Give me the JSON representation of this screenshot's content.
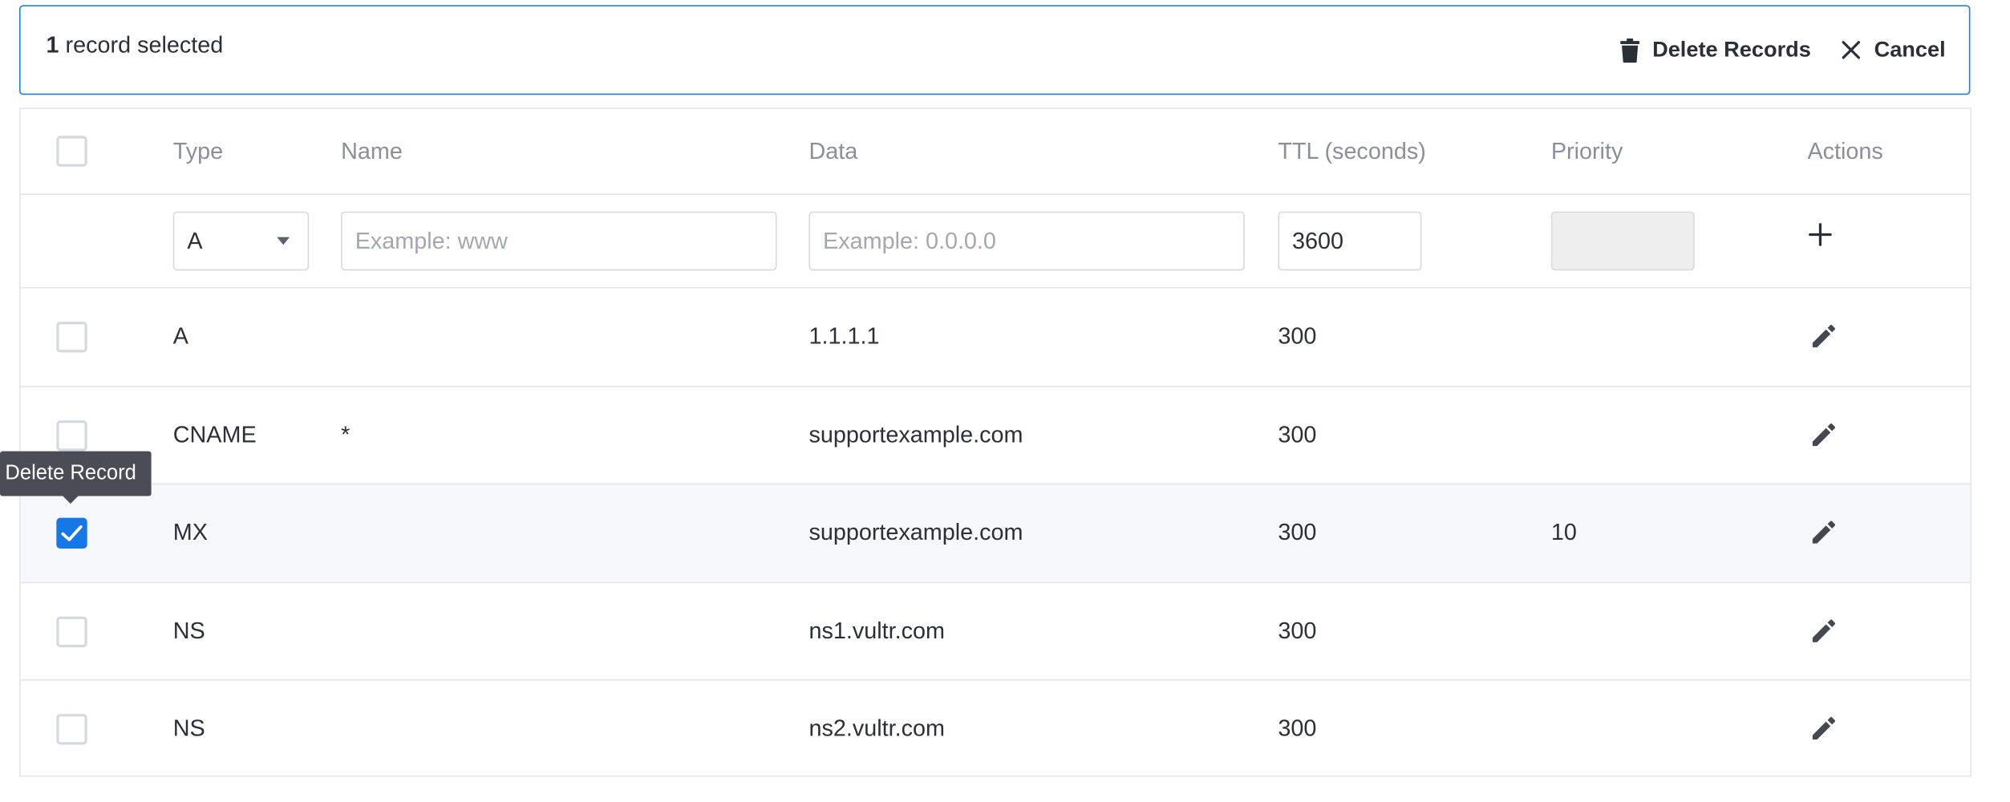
{
  "selection_bar": {
    "count": "1",
    "count_suffix": "record selected",
    "delete_label": "Delete Records",
    "cancel_label": "Cancel"
  },
  "columns": {
    "type": "Type",
    "name": "Name",
    "data": "Data",
    "ttl": "TTL (seconds)",
    "priority": "Priority",
    "actions": "Actions"
  },
  "new_record": {
    "type_value": "A",
    "name_placeholder": "Example: www",
    "data_placeholder": "Example: 0.0.0.0",
    "ttl_value": "3600",
    "priority_value": ""
  },
  "records": [
    {
      "type": "A",
      "name": "",
      "data": "1.1.1.1",
      "ttl": "300",
      "priority": "",
      "checked": false
    },
    {
      "type": "CNAME",
      "name": "*",
      "data": "supportexample.com",
      "ttl": "300",
      "priority": "",
      "checked": false
    },
    {
      "type": "MX",
      "name": "",
      "data": "supportexample.com",
      "ttl": "300",
      "priority": "10",
      "checked": true
    },
    {
      "type": "NS",
      "name": "",
      "data": "ns1.vultr.com",
      "ttl": "300",
      "priority": "",
      "checked": false
    },
    {
      "type": "NS",
      "name": "",
      "data": "ns2.vultr.com",
      "ttl": "300",
      "priority": "",
      "checked": false
    }
  ],
  "tooltip": "Delete Record",
  "colors": {
    "accent": "#1677e6",
    "border": "#e3e5ea",
    "tooltip_bg": "#4a4d55"
  }
}
